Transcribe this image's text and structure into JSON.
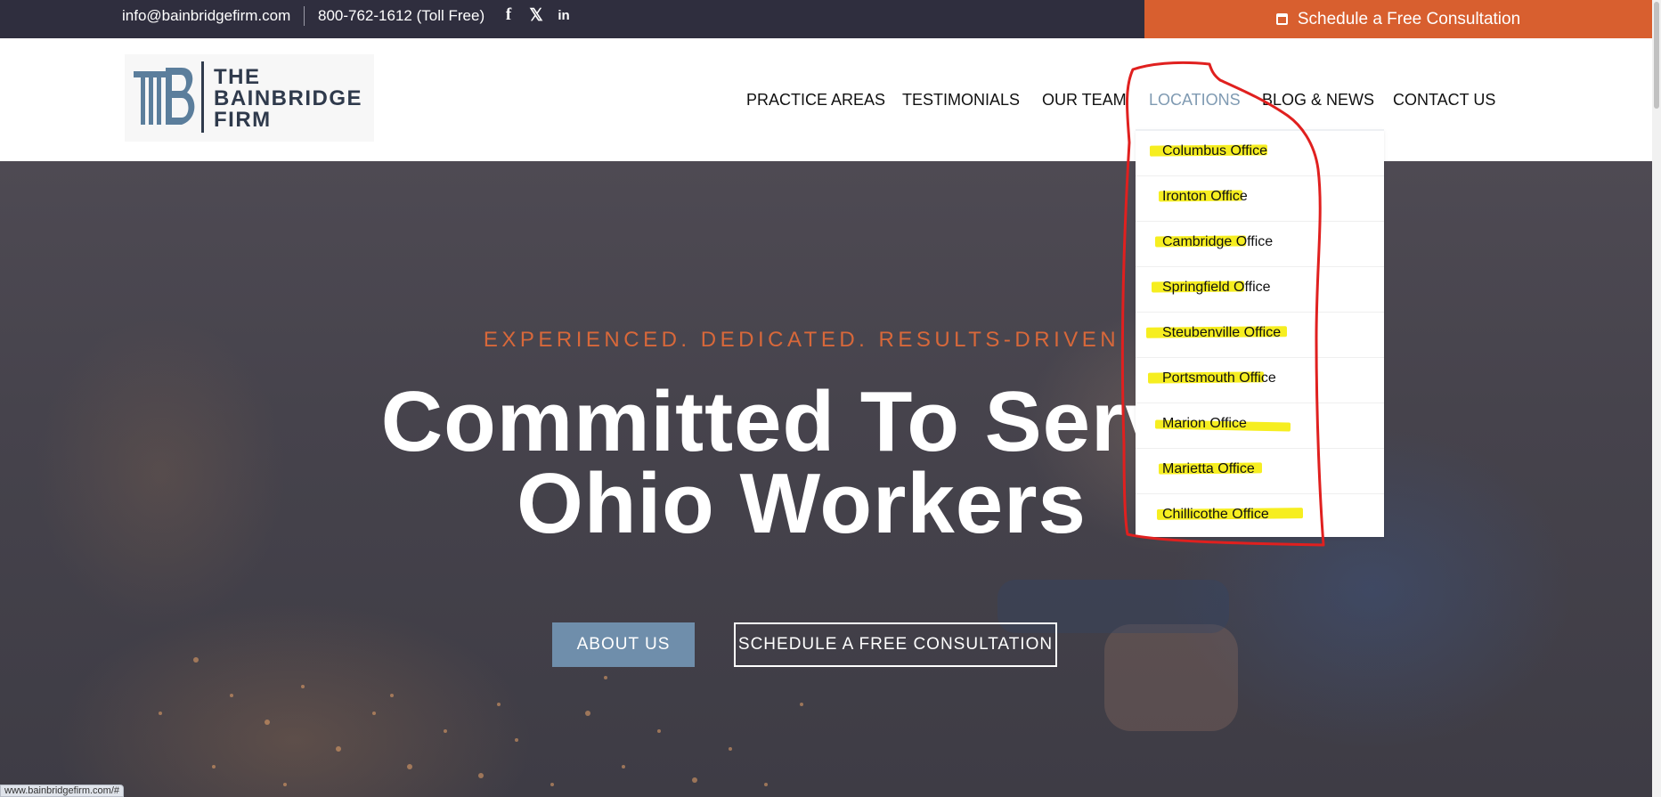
{
  "topbar": {
    "email": "info@bainbridgefirm.com",
    "phone": "800-762-1612 (Toll Free)",
    "social": [
      {
        "icon": "facebook-icon",
        "glyph": "f"
      },
      {
        "icon": "x-twitter-icon",
        "glyph": "𝕏"
      },
      {
        "icon": "linkedin-icon",
        "glyph": "in"
      }
    ],
    "cta_label": "Schedule a Free Consultation"
  },
  "logo": {
    "line1": "THE",
    "line2": "BAINBRIDGE",
    "line3": "FIRM"
  },
  "nav": {
    "items": [
      {
        "label": "PRACTICE AREAS"
      },
      {
        "label": "TESTIMONIALS"
      },
      {
        "label": "OUR TEAM"
      },
      {
        "label": "LOCATIONS",
        "active": true
      },
      {
        "label": "BLOG & NEWS"
      },
      {
        "label": "CONTACT US"
      }
    ]
  },
  "locations_menu": {
    "items": [
      {
        "label": "Columbus Office"
      },
      {
        "label": "Ironton Office"
      },
      {
        "label": "Cambridge Office"
      },
      {
        "label": "Springfield Office"
      },
      {
        "label": "Steubenville Office"
      },
      {
        "label": "Portsmouth Office"
      },
      {
        "label": "Marion Office"
      },
      {
        "label": "Marietta Office"
      },
      {
        "label": "Chillicothe Office"
      }
    ]
  },
  "hero": {
    "tagline": "EXPERIENCED. DEDICATED. RESULTS-DRIVEN",
    "headline_line1": "Committed To Serve",
    "headline_line2": "Ohio Workers",
    "about_button": "ABOUT US",
    "schedule_button": "SCHEDULE A FREE CONSULTATION"
  },
  "status_bar": {
    "url": "www.bainbridgefirm.com/#"
  },
  "colors": {
    "topbar_bg": "#2f2e3e",
    "accent_orange": "#d85f2f",
    "brand_blue": "#6f8eab",
    "nav_active": "#7f9ab2",
    "annotation_red": "#e0201f",
    "highlighter_yellow": "#f6ee20"
  }
}
